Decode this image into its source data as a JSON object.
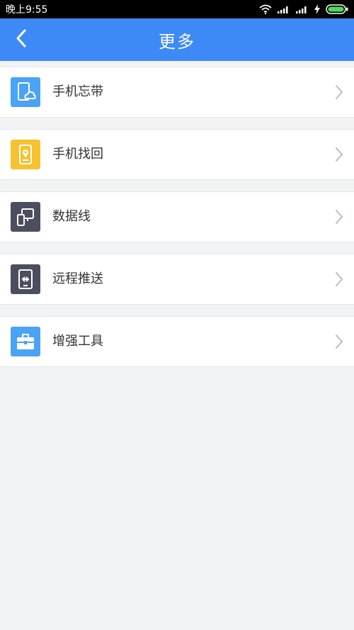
{
  "status_bar": {
    "time": "晚上9:55",
    "icons": [
      "wifi-icon",
      "signal-icon",
      "signal-icon",
      "charging-icon",
      "battery-icon"
    ]
  },
  "header": {
    "title": "更多",
    "back_icon": "chevron-left-icon",
    "background": "#3d8af7"
  },
  "menu": {
    "items": [
      {
        "label": "手机忘带",
        "icon": "phone-cloud-icon",
        "icon_color": "#4aa3f5"
      },
      {
        "label": "手机找回",
        "icon": "phone-locate-icon",
        "icon_color": "#f5c230"
      },
      {
        "label": "数据线",
        "icon": "devices-icon",
        "icon_color": "#4b4e5e"
      },
      {
        "label": "远程推送",
        "icon": "remote-push-icon",
        "icon_color": "#4b4e5e"
      },
      {
        "label": "增强工具",
        "icon": "toolbox-icon",
        "icon_color": "#4aa3f5"
      }
    ]
  }
}
